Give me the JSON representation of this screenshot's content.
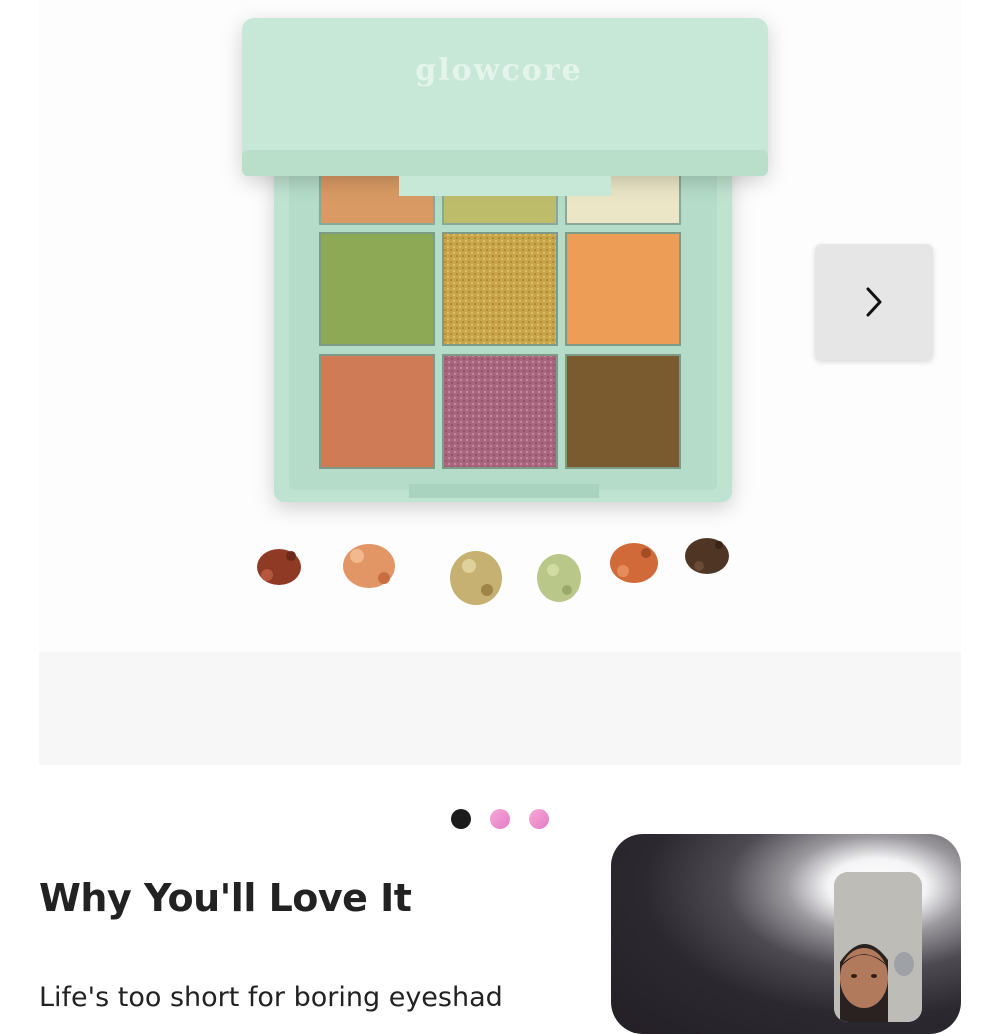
{
  "product": {
    "brand_text": "glowcore",
    "alt": "Glowcore eyeshadow palette"
  },
  "gallery": {
    "next_icon": "chevron-right-icon",
    "dots": [
      {
        "state": "active",
        "color": "#1c1c1c"
      },
      {
        "state": "inactive",
        "color": "#e98ad0"
      },
      {
        "state": "inactive",
        "color": "#e98ad0"
      }
    ]
  },
  "section": {
    "heading": "Why You'll Love It",
    "body": "Life's too short for boring eyeshad"
  },
  "video": {
    "icon": "video-call-icon"
  },
  "colors": {
    "palette_case": "#bfe3d1",
    "heading_text": "#222222"
  }
}
